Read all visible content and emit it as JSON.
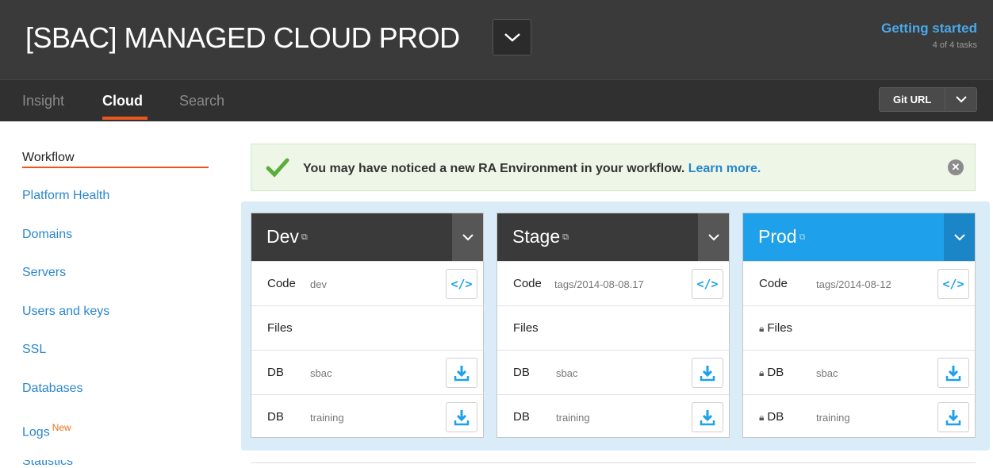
{
  "header": {
    "title": "[SBAC] MANAGED CLOUD PROD",
    "getting_started": {
      "title": "Getting started",
      "subtitle": "4 of 4 tasks"
    }
  },
  "nav": {
    "tabs": [
      {
        "label": "Insight",
        "active": false
      },
      {
        "label": "Cloud",
        "active": true
      },
      {
        "label": "Search",
        "active": false
      }
    ],
    "git_button": "Git URL"
  },
  "sidebar": {
    "items": [
      {
        "label": "Workflow",
        "active": true
      },
      {
        "label": "Platform Health"
      },
      {
        "label": "Domains"
      },
      {
        "label": "Servers"
      },
      {
        "label": "Users and keys"
      },
      {
        "label": "SSL"
      },
      {
        "label": "Databases"
      },
      {
        "label": "Logs",
        "badge": "New"
      },
      {
        "label": "Statistics"
      }
    ]
  },
  "notice": {
    "text": "You may have noticed a new RA Environment in your workflow.",
    "link": "Learn more."
  },
  "environments": [
    {
      "name": "Dev",
      "code_label": "Code",
      "code_value": "dev",
      "files_label": "Files",
      "db_rows": [
        {
          "label": "DB",
          "value": "sbac"
        },
        {
          "label": "DB",
          "value": "training"
        }
      ]
    },
    {
      "name": "Stage",
      "code_label": "Code",
      "code_value": "tags/2014-08-08.17",
      "files_label": "Files",
      "db_rows": [
        {
          "label": "DB",
          "value": "sbac"
        },
        {
          "label": "DB",
          "value": "training"
        }
      ]
    },
    {
      "name": "Prod",
      "code_label": "Code",
      "code_value": "tags/2014-08-12",
      "files_label": "Files",
      "db_rows": [
        {
          "label": "DB",
          "value": "sbac"
        },
        {
          "label": "DB",
          "value": "training"
        }
      ]
    }
  ],
  "colors": {
    "accent_blue": "#1ea0ea",
    "accent_orange": "#e8571e",
    "header_bg": "#3a3a3a"
  }
}
